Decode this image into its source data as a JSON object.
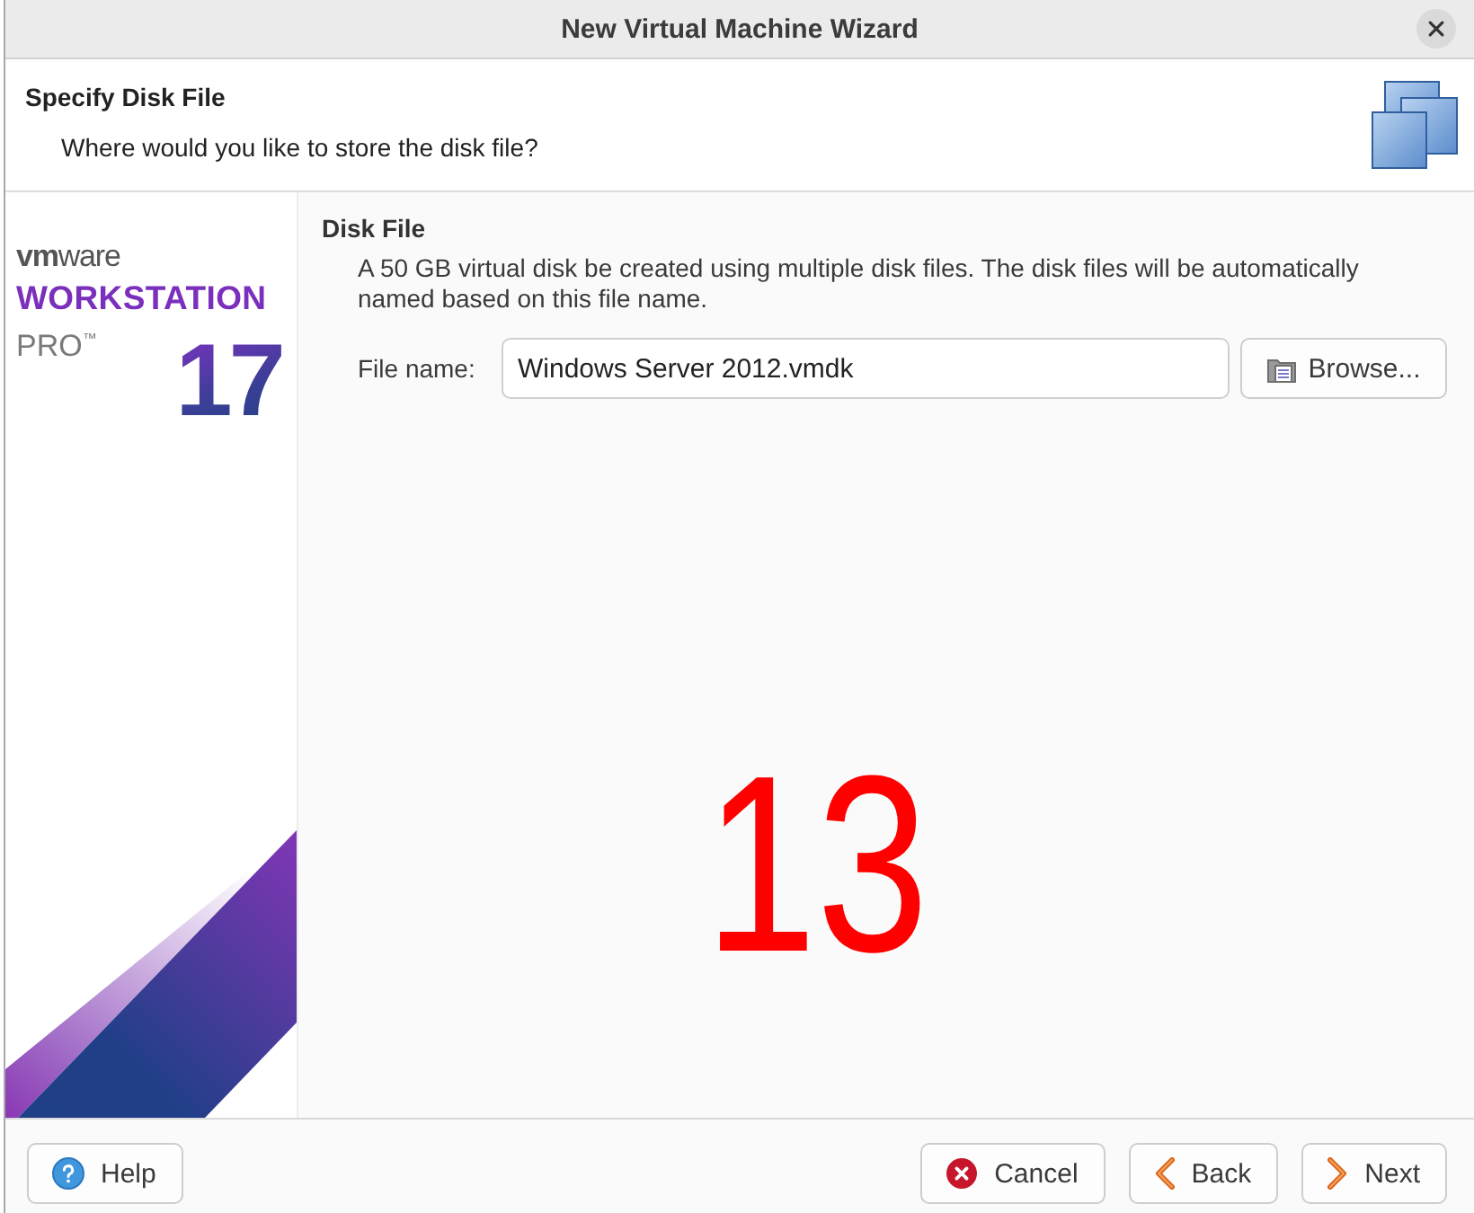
{
  "window": {
    "title": "New Virtual Machine Wizard"
  },
  "header": {
    "title": "Specify Disk File",
    "subtitle": "Where would you like to store the disk file?"
  },
  "sidebar": {
    "brand": "**vm**ware",
    "product": "WORKSTATION",
    "edition": "PRO$^{™}$",
    "version": "17"
  },
  "section": {
    "title": "Disk File",
    "description": "A 50 GB virtual disk be created using multiple disk files. The disk files will be automatically named based on this file name.",
    "field_label": "File name:",
    "field_value": "Windows Server 2012.vmdk",
    "browse_button": "Browse..."
  },
  "annotation": "13",
  "buttons": [
    {
      "kind": "help",
      "label": "Help"
    },
    {
      "kind": "cancel",
      "label": "Cancel"
    },
    {
      "kind": "back",
      "label": "Back"
    },
    {
      "kind": "next",
      "label": "Next"
    }
  ]
}
